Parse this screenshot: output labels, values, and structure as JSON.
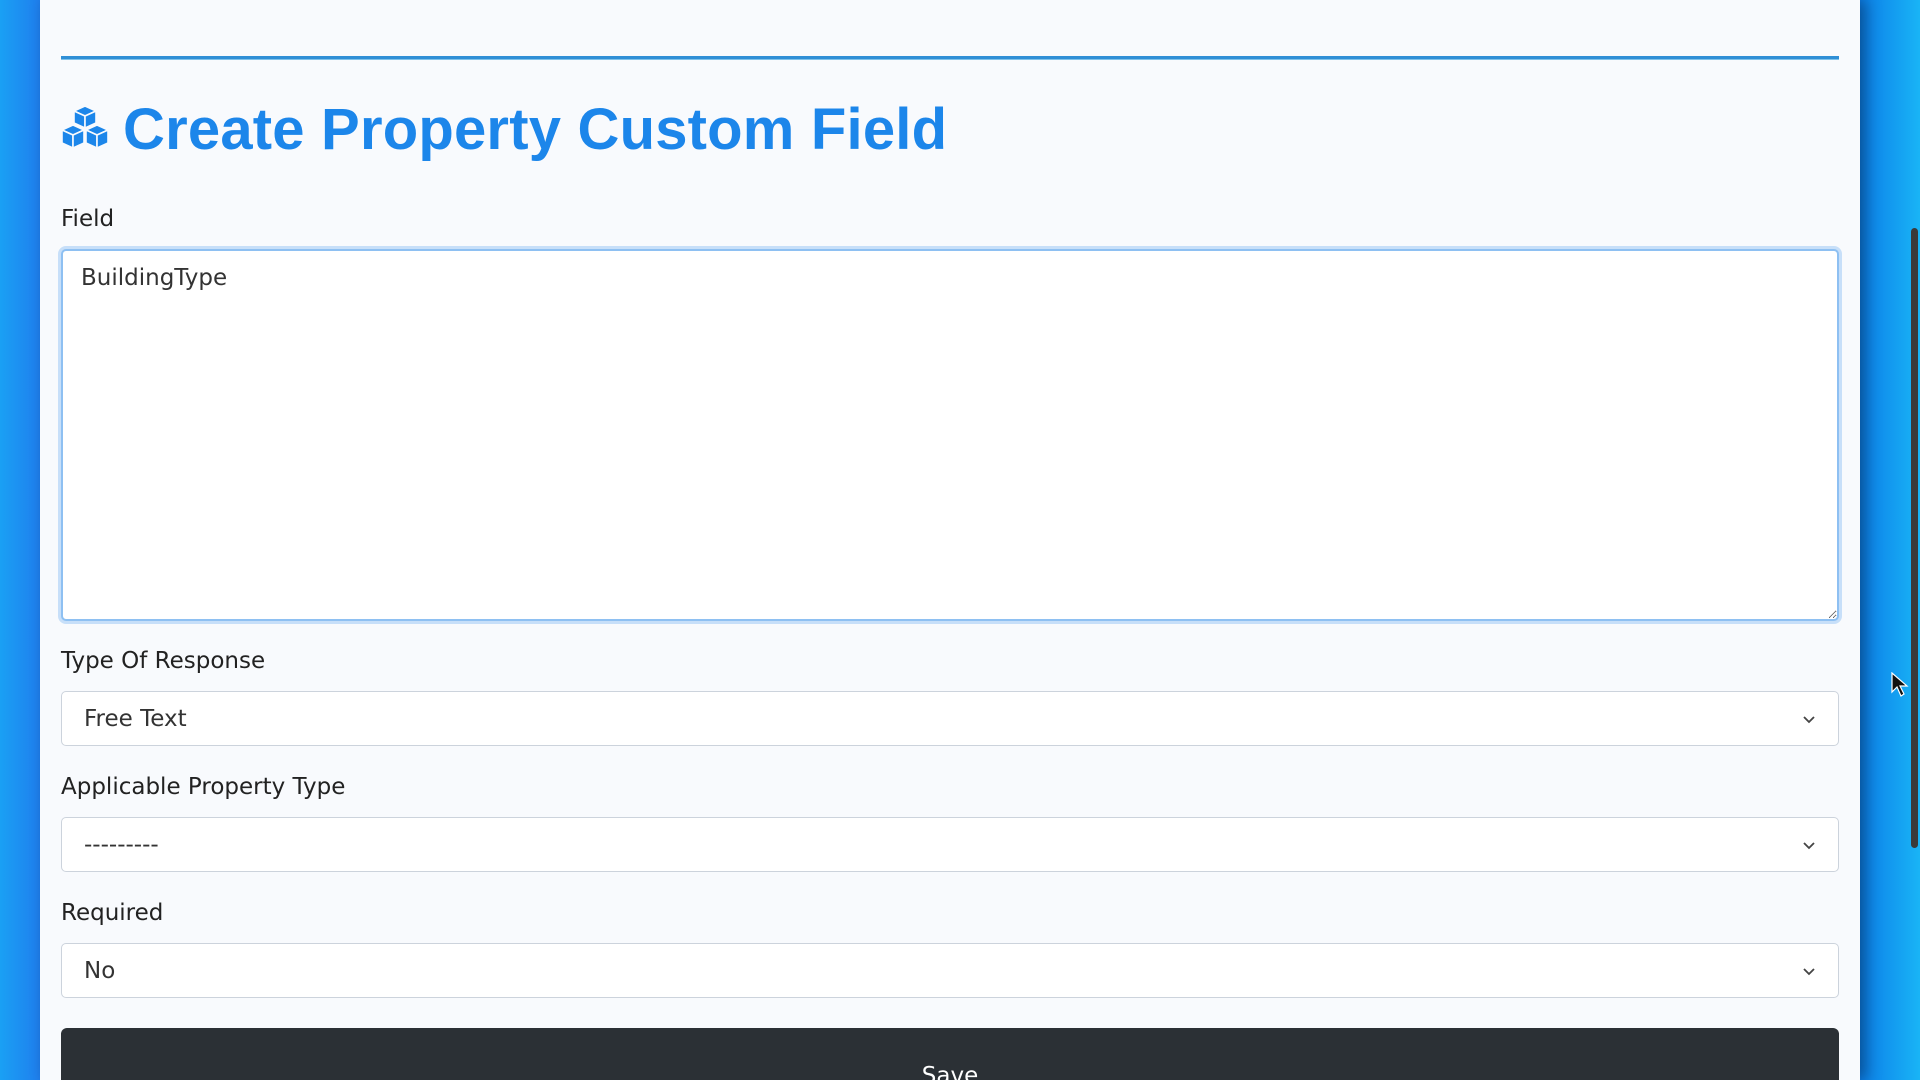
{
  "page": {
    "title": "Create Property Custom Field"
  },
  "form": {
    "field": {
      "label": "Field",
      "value": "BuildingType"
    },
    "type_of_response": {
      "label": "Type Of Response",
      "selected": "Free Text"
    },
    "applicable_property_type": {
      "label": "Applicable Property Type",
      "selected": "---------"
    },
    "required": {
      "label": "Required",
      "selected": "No"
    },
    "save_label": "Save"
  },
  "icons": {
    "title_icon": "cubes-icon",
    "dropdown_icon": "chevron-down-icon"
  },
  "colors": {
    "accent": "#1c86ea",
    "button": "#2b3035",
    "focus_border": "#8ec0f2"
  }
}
